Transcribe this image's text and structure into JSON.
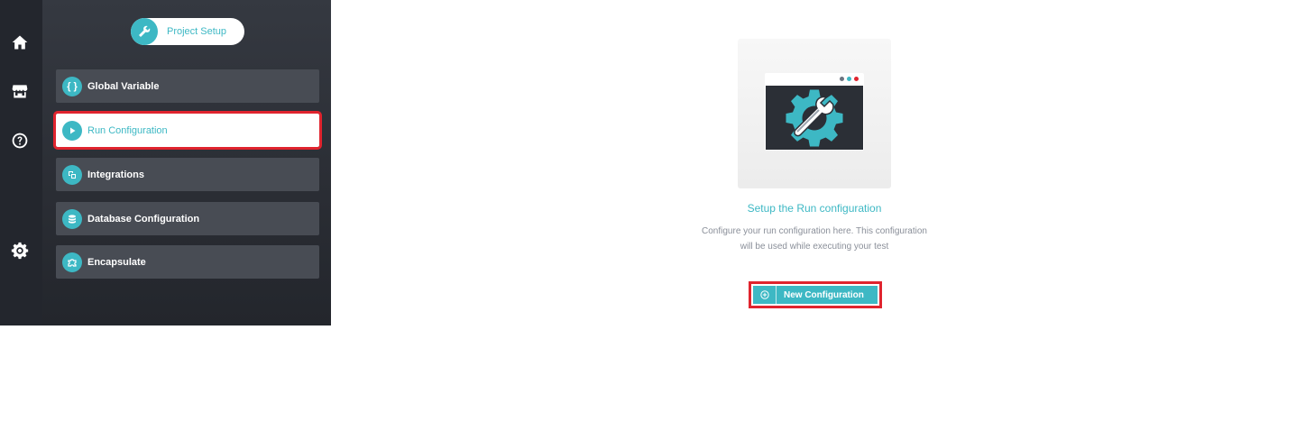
{
  "rail": {
    "icons": [
      "home-icon",
      "store-icon",
      "help-icon",
      "settings-icon"
    ]
  },
  "sidebar": {
    "header_label": "Project Setup",
    "items": [
      {
        "label": "Global Variable",
        "icon": "braces-icon"
      },
      {
        "label": "Run Configuration",
        "icon": "play-icon",
        "active": true
      },
      {
        "label": "Integrations",
        "icon": "integrations-icon"
      },
      {
        "label": "Database Configuration",
        "icon": "database-icon"
      },
      {
        "label": "Encapsulate",
        "icon": "puzzle-icon"
      }
    ]
  },
  "main": {
    "empty_title": "Setup the Run configuration",
    "empty_desc_line1": "Configure your run configuration here. This configuration",
    "empty_desc_line2": "will be used while executing your test",
    "new_button_label": "New Configuration"
  },
  "colors": {
    "accent": "#3db8c4",
    "highlight": "#e0242e",
    "rail_bg": "#23262d",
    "panel_bg": "#353941"
  }
}
